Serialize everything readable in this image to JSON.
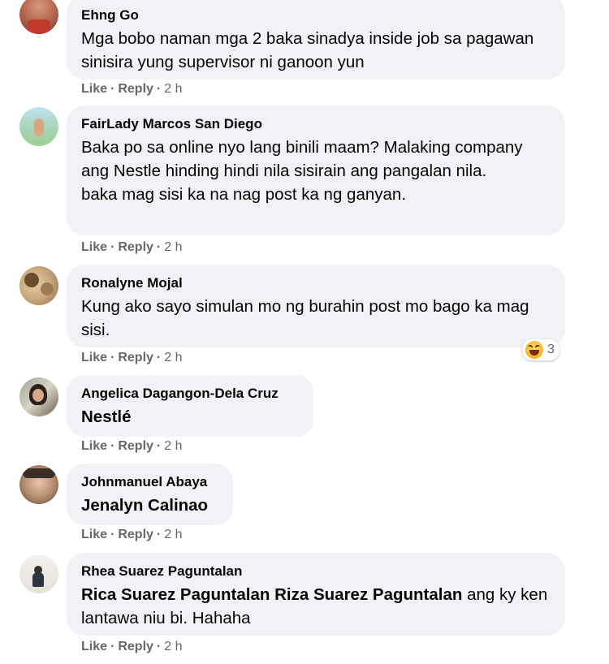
{
  "comments": [
    {
      "author": "Ehng Go",
      "text": "Mga bobo naman mga 2 baka sinadya inside job sa pagawan sinisira yung supervisor ni ganoon yun",
      "like": "Like",
      "reply": "Reply",
      "time": "2 h"
    },
    {
      "author": "FairLady Marcos San Diego",
      "text": "Baka po sa online nyo lang binili maam? Malaking company ang Nestle hinding hindi nila sisirain ang pangalan nila.\nbaka mag sisi ka na nag post ka ng ganyan.",
      "like": "Like",
      "reply": "Reply",
      "time": "2 h"
    },
    {
      "author": "Ronalyne Mojal",
      "text": "Kung ako sayo simulan mo ng burahin post mo bago ka mag sisi.",
      "like": "Like",
      "reply": "Reply",
      "time": "2 h",
      "reaction": {
        "icon": "haha-emoji-icon",
        "count": "3"
      }
    },
    {
      "author": "Angelica Dagangon-Dela Cruz",
      "tag": "Nestlé",
      "like": "Like",
      "reply": "Reply",
      "time": "2 h"
    },
    {
      "author": "Johnmanuel Abaya",
      "tag": "Jenalyn Calinao",
      "like": "Like",
      "reply": "Reply",
      "time": "2 h"
    },
    {
      "author": "Rhea Suarez Paguntalan",
      "tag1": "Rica Suarez Paguntalan",
      "tag2": "Riza Suarez Paguntalan",
      "text": " ang ky ken lantawa niu bi. Hahaha",
      "like": "Like",
      "reply": "Reply",
      "time": "2 h"
    }
  ],
  "separator": "·",
  "colors": {
    "bubble": "#f0f2f5",
    "meta": "#65676b",
    "text": "#050505"
  }
}
